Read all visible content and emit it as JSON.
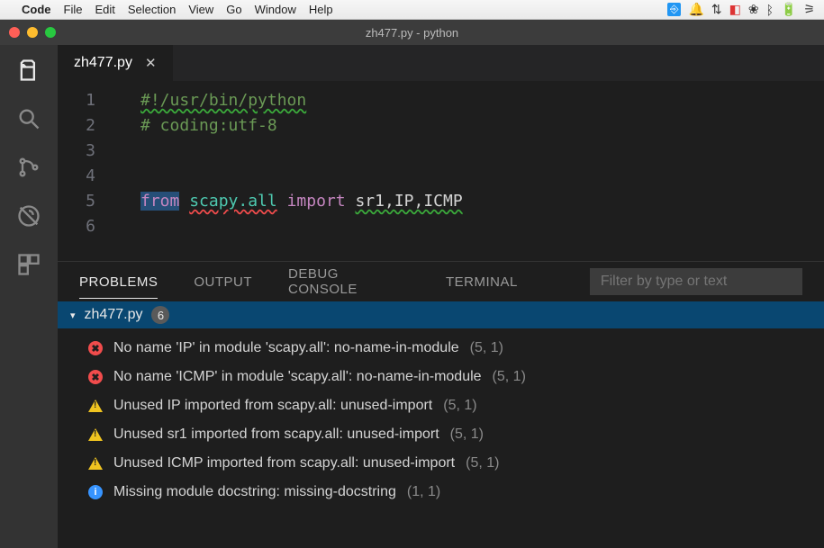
{
  "mac_menu": {
    "app": "Code",
    "items": [
      "File",
      "Edit",
      "Selection",
      "View",
      "Go",
      "Window",
      "Help"
    ]
  },
  "window": {
    "title": "zh477.py - python"
  },
  "tab": {
    "filename": "zh477.py"
  },
  "editor": {
    "lines": [
      {
        "n": "1",
        "seg": [
          {
            "t": "#!/usr/bin/python",
            "cls": "c-comment sq-grn"
          }
        ]
      },
      {
        "n": "2",
        "seg": [
          {
            "t": "# coding:utf-8",
            "cls": "c-comment"
          }
        ]
      },
      {
        "n": "3",
        "seg": []
      },
      {
        "n": "4",
        "seg": []
      },
      {
        "n": "5",
        "seg": [
          {
            "t": "from",
            "cls": "c-kw hl-sel"
          },
          {
            "t": " ",
            "cls": "c-plain"
          },
          {
            "t": "scapy.all",
            "cls": "c-mod sq-red"
          },
          {
            "t": " ",
            "cls": "c-plain"
          },
          {
            "t": "import",
            "cls": "c-kw"
          },
          {
            "t": " ",
            "cls": "c-plain"
          },
          {
            "t": "sr1,IP,ICMP",
            "cls": "c-plain sq-grn"
          }
        ]
      },
      {
        "n": "6",
        "seg": []
      }
    ]
  },
  "panel": {
    "tabs": [
      "PROBLEMS",
      "OUTPUT",
      "DEBUG CONSOLE",
      "TERMINAL"
    ],
    "active": 0,
    "filter_placeholder": "Filter by type or text",
    "file": {
      "name": "zh477.py",
      "count": "6"
    },
    "problems": [
      {
        "sev": "err",
        "msg": "No name 'IP' in module 'scapy.all': no-name-in-module",
        "loc": "(5, 1)"
      },
      {
        "sev": "err",
        "msg": "No name 'ICMP' in module 'scapy.all': no-name-in-module",
        "loc": "(5, 1)"
      },
      {
        "sev": "warn",
        "msg": "Unused IP imported from scapy.all: unused-import",
        "loc": "(5, 1)"
      },
      {
        "sev": "warn",
        "msg": "Unused sr1 imported from scapy.all: unused-import",
        "loc": "(5, 1)"
      },
      {
        "sev": "warn",
        "msg": "Unused ICMP imported from scapy.all: unused-import",
        "loc": "(5, 1)"
      },
      {
        "sev": "info",
        "msg": "Missing module docstring: missing-docstring",
        "loc": "(1, 1)"
      }
    ]
  }
}
